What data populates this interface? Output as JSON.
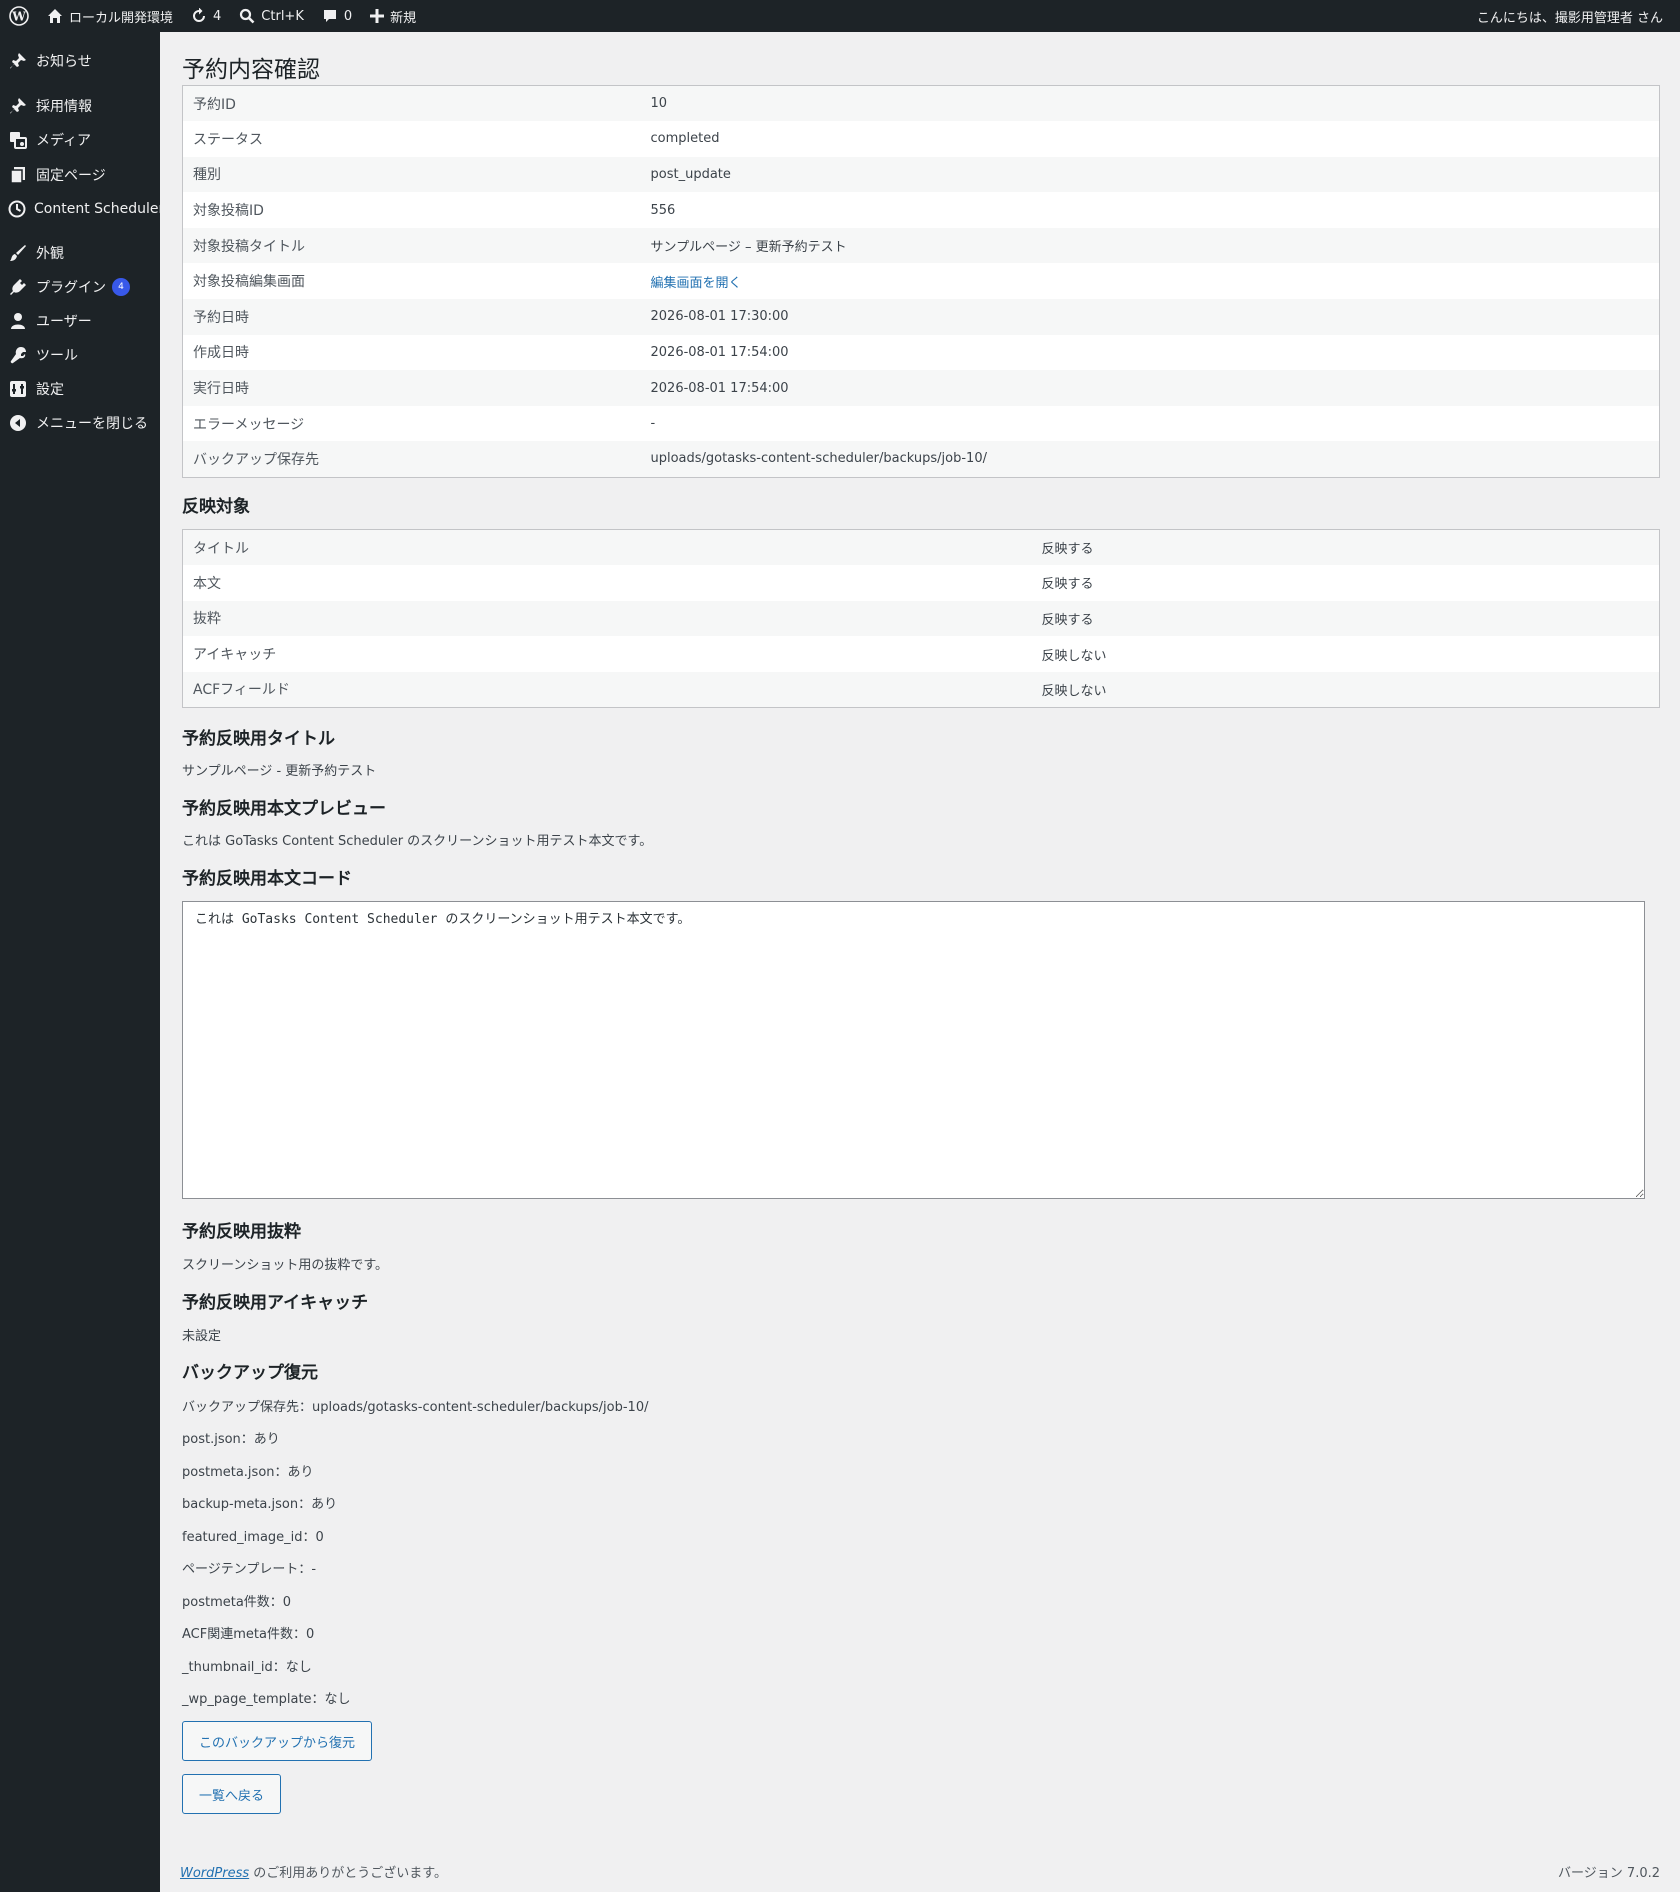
{
  "adminbar": {
    "site_name": "ローカル開発環境",
    "updates_count": "4",
    "search_shortcut": "Ctrl+K",
    "comments_count": "0",
    "new_label": "新規",
    "greeting": "こんにちは、撮影用管理者 さん"
  },
  "sidebar": {
    "items": [
      {
        "label": "お知らせ",
        "icon": "pin-icon"
      },
      {
        "label": "採用情報",
        "icon": "pin-icon"
      },
      {
        "label": "メディア",
        "icon": "media-icon"
      },
      {
        "label": "固定ページ",
        "icon": "pages-icon"
      },
      {
        "label": "Content Scheduler",
        "icon": "clock-icon"
      },
      {
        "label": "外観",
        "icon": "brush-icon"
      },
      {
        "label": "プラグイン",
        "icon": "plugin-icon",
        "badge": "4"
      },
      {
        "label": "ユーザー",
        "icon": "user-icon"
      },
      {
        "label": "ツール",
        "icon": "wrench-icon"
      },
      {
        "label": "設定",
        "icon": "settings-icon"
      },
      {
        "label": "メニューを閉じる",
        "icon": "collapse-icon"
      }
    ]
  },
  "page": {
    "title": "予約内容確認",
    "details": [
      {
        "label": "予約ID",
        "value": "10"
      },
      {
        "label": "ステータス",
        "value": "completed"
      },
      {
        "label": "種別",
        "value": "post_update"
      },
      {
        "label": "対象投稿ID",
        "value": "556"
      },
      {
        "label": "対象投稿タイトル",
        "value": "サンプルページ – 更新予約テスト"
      },
      {
        "label": "対象投稿編集画面",
        "value": "編集画面を開く",
        "link": true
      },
      {
        "label": "予約日時",
        "value": "2026-08-01 17:30:00"
      },
      {
        "label": "作成日時",
        "value": "2026-08-01 17:54:00"
      },
      {
        "label": "実行日時",
        "value": "2026-08-01 17:54:00"
      },
      {
        "label": "エラーメッセージ",
        "value": "-"
      },
      {
        "label": "バックアップ保存先",
        "value": "uploads/gotasks-content-scheduler/backups/job-10/"
      }
    ],
    "targets_heading": "反映対象",
    "targets": [
      {
        "label": "タイトル",
        "value": "反映する"
      },
      {
        "label": "本文",
        "value": "反映する"
      },
      {
        "label": "抜粋",
        "value": "反映する"
      },
      {
        "label": "アイキャッチ",
        "value": "反映しない"
      },
      {
        "label": "ACFフィールド",
        "value": "反映しない"
      }
    ],
    "title_heading": "予約反映用タイトル",
    "title_value": "サンプルページ - 更新予約テスト",
    "preview_heading": "予約反映用本文プレビュー",
    "preview_value": "これは GoTasks Content Scheduler のスクリーンショット用テスト本文です。",
    "code_heading": "予約反映用本文コード",
    "code_value": "これは GoTasks Content Scheduler のスクリーンショット用テスト本文です。",
    "excerpt_heading": "予約反映用抜粋",
    "excerpt_value": "スクリーンショット用の抜粋です。",
    "thumb_heading": "予約反映用アイキャッチ",
    "thumb_value": "未設定",
    "backup_heading": "バックアップ復元",
    "backup_lines": [
      "バックアップ保存先：uploads/gotasks-content-scheduler/backups/job-10/",
      "post.json：あり",
      "postmeta.json：あり",
      "backup-meta.json：あり",
      "featured_image_id：0",
      "ページテンプレート：-",
      "postmeta件数：0",
      "ACF関連meta件数：0",
      "_thumbnail_id：なし",
      "_wp_page_template：なし"
    ],
    "restore_button": "このバックアップから復元",
    "back_button": "一覧へ戻る"
  },
  "footer": {
    "wp_link": "WordPress",
    "thanks": " のご利用ありがとうございます。",
    "version": "バージョン 7.0.2"
  }
}
